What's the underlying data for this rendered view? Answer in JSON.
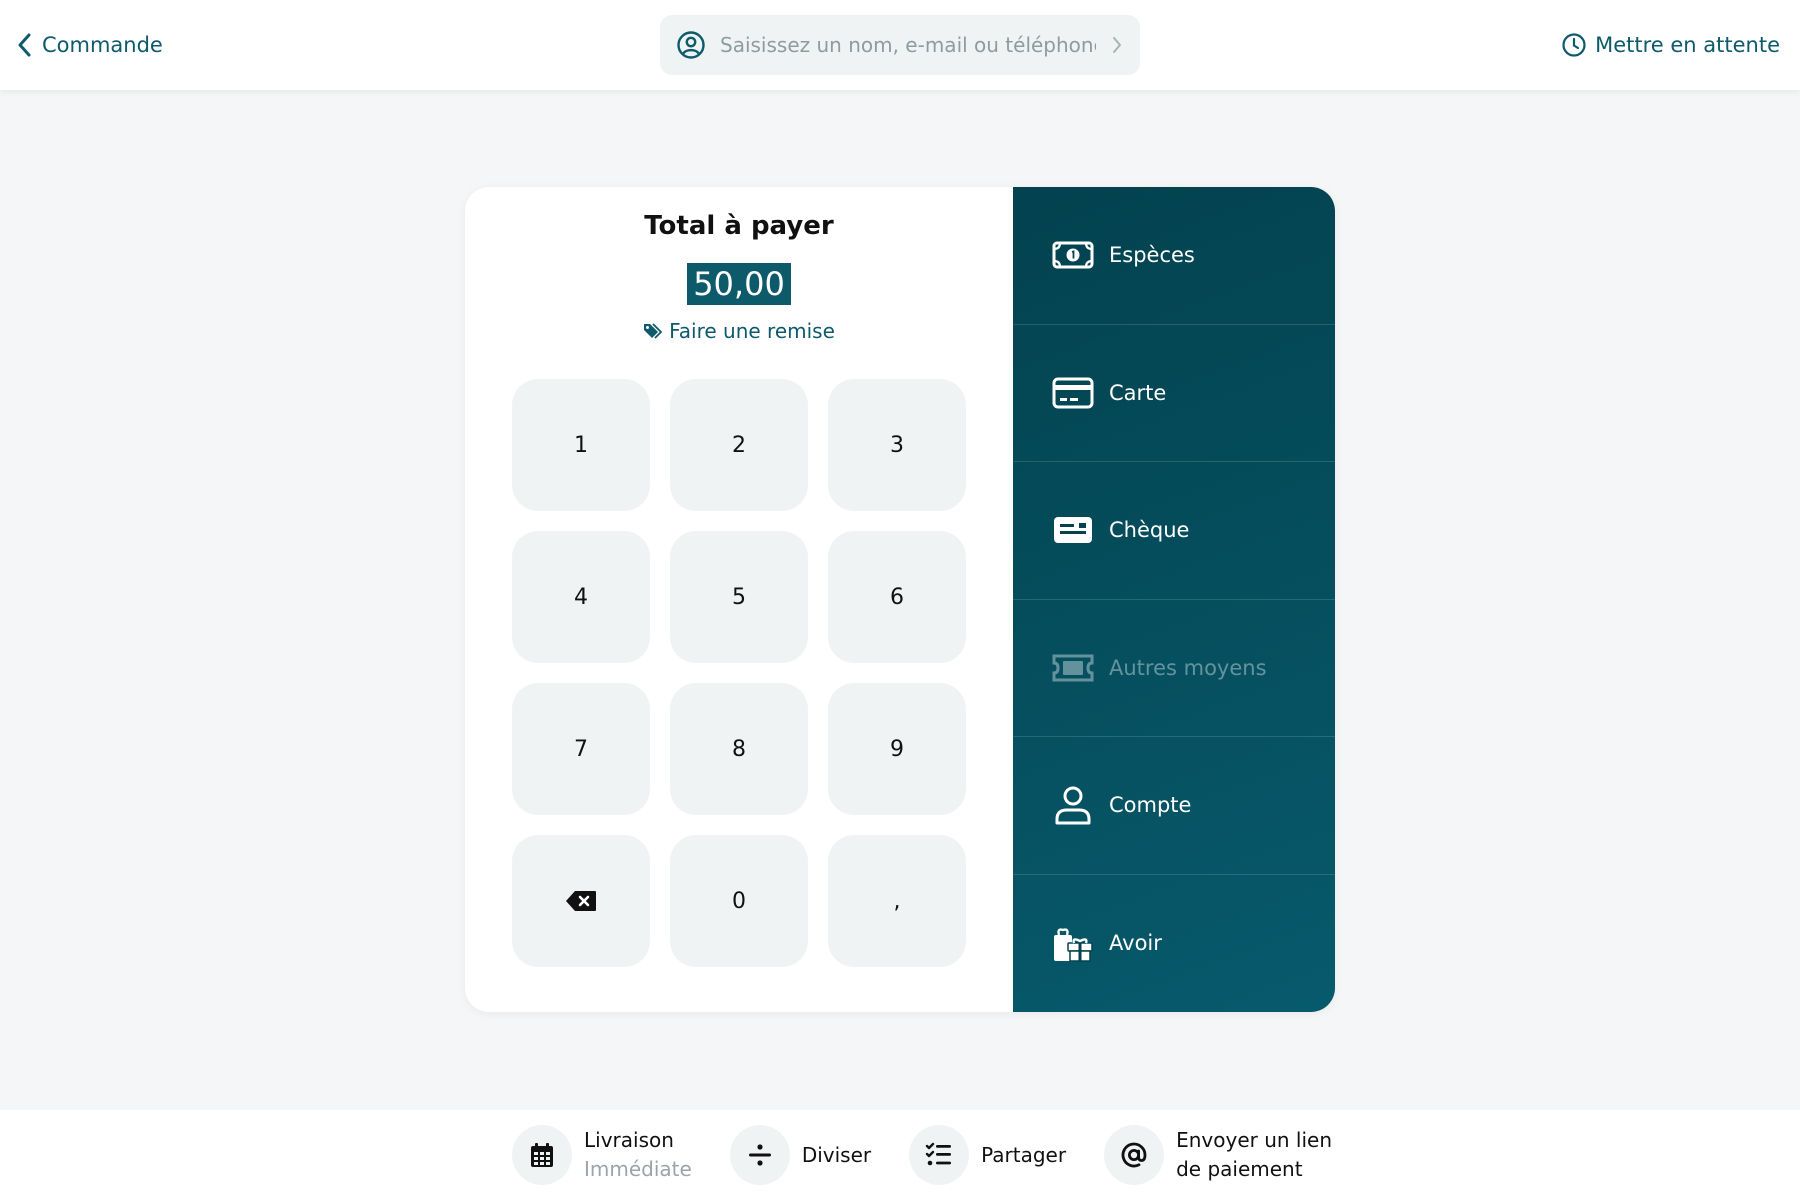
{
  "header": {
    "back_label": "Commande",
    "search_placeholder": "Saisissez un nom, e-mail ou téléphone",
    "hold_label": "Mettre en attente"
  },
  "payment": {
    "title": "Total à payer",
    "amount": "50,00",
    "discount_label": "Faire une remise"
  },
  "keypad": {
    "keys": [
      "1",
      "2",
      "3",
      "4",
      "5",
      "6",
      "7",
      "8",
      "9",
      "backspace",
      "0",
      ","
    ]
  },
  "methods": [
    {
      "label": "Espèces",
      "icon": "cash-icon",
      "enabled": true
    },
    {
      "label": "Carte",
      "icon": "credit-card-icon",
      "enabled": true
    },
    {
      "label": "Chèque",
      "icon": "cheque-icon",
      "enabled": true
    },
    {
      "label": "Autres moyens",
      "icon": "ticket-icon",
      "enabled": false
    },
    {
      "label": "Compte",
      "icon": "user-icon",
      "enabled": true
    },
    {
      "label": "Avoir",
      "icon": "gifts-icon",
      "enabled": true
    }
  ],
  "footer": {
    "delivery_label": "Livraison",
    "delivery_value": "Immédiate",
    "split_label": "Diviser",
    "share_label": "Partager",
    "payment_link_line1": "Envoyer un lien",
    "payment_link_line2": "de paiement"
  },
  "colors": {
    "accent": "#0d5a6b",
    "panel_dark": "#03424f",
    "key_bg": "#f0f3f4",
    "page_bg": "#f5f6f7"
  }
}
